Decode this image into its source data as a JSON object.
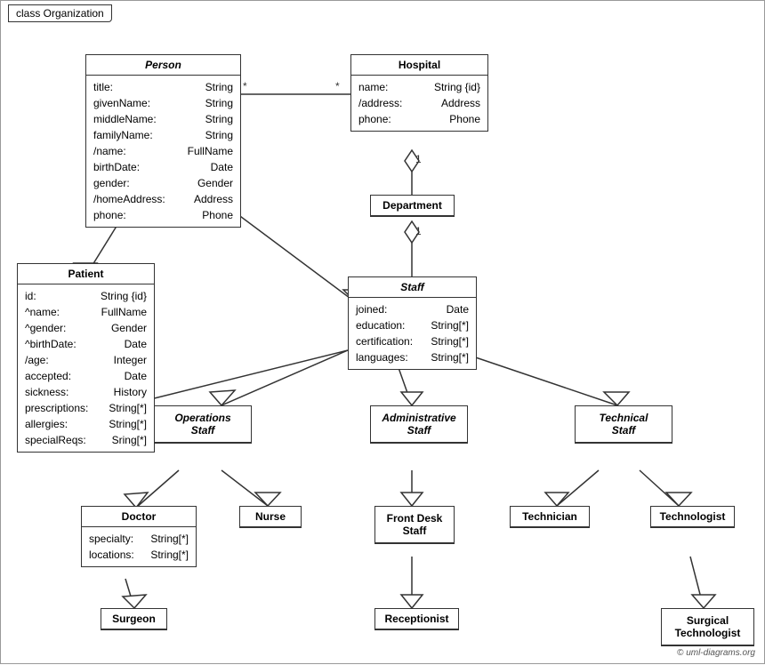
{
  "diagram": {
    "title": "class Organization",
    "copyright": "© uml-diagrams.org",
    "classes": {
      "person": {
        "name": "Person",
        "italic": true,
        "attributes": [
          {
            "name": "title:",
            "type": "String"
          },
          {
            "name": "givenName:",
            "type": "String"
          },
          {
            "name": "middleName:",
            "type": "String"
          },
          {
            "name": "familyName:",
            "type": "String"
          },
          {
            "name": "/name:",
            "type": "FullName"
          },
          {
            "name": "birthDate:",
            "type": "Date"
          },
          {
            "name": "gender:",
            "type": "Gender"
          },
          {
            "name": "/homeAddress:",
            "type": "Address"
          },
          {
            "name": "phone:",
            "type": "Phone"
          }
        ]
      },
      "hospital": {
        "name": "Hospital",
        "italic": false,
        "attributes": [
          {
            "name": "name:",
            "type": "String {id}"
          },
          {
            "name": "/address:",
            "type": "Address"
          },
          {
            "name": "phone:",
            "type": "Phone"
          }
        ]
      },
      "department": {
        "name": "Department",
        "italic": false,
        "attributes": []
      },
      "staff": {
        "name": "Staff",
        "italic": true,
        "attributes": [
          {
            "name": "joined:",
            "type": "Date"
          },
          {
            "name": "education:",
            "type": "String[*]"
          },
          {
            "name": "certification:",
            "type": "String[*]"
          },
          {
            "name": "languages:",
            "type": "String[*]"
          }
        ]
      },
      "patient": {
        "name": "Patient",
        "italic": false,
        "attributes": [
          {
            "name": "id:",
            "type": "String {id}"
          },
          {
            "name": "^name:",
            "type": "FullName"
          },
          {
            "name": "^gender:",
            "type": "Gender"
          },
          {
            "name": "^birthDate:",
            "type": "Date"
          },
          {
            "name": "/age:",
            "type": "Integer"
          },
          {
            "name": "accepted:",
            "type": "Date"
          },
          {
            "name": "sickness:",
            "type": "History"
          },
          {
            "name": "prescriptions:",
            "type": "String[*]"
          },
          {
            "name": "allergies:",
            "type": "String[*]"
          },
          {
            "name": "specialReqs:",
            "type": "Sring[*]"
          }
        ]
      },
      "operations_staff": {
        "name": "Operations Staff",
        "italic": true
      },
      "administrative_staff": {
        "name": "Administrative Staff",
        "italic": true
      },
      "technical_staff": {
        "name": "Technical Staff",
        "italic": true
      },
      "doctor": {
        "name": "Doctor",
        "italic": false,
        "attributes": [
          {
            "name": "specialty:",
            "type": "String[*]"
          },
          {
            "name": "locations:",
            "type": "String[*]"
          }
        ]
      },
      "nurse": {
        "name": "Nurse",
        "italic": false,
        "attributes": []
      },
      "front_desk_staff": {
        "name": "Front Desk Staff",
        "italic": false,
        "attributes": []
      },
      "technician": {
        "name": "Technician",
        "italic": false,
        "attributes": []
      },
      "technologist": {
        "name": "Technologist",
        "italic": false,
        "attributes": []
      },
      "surgeon": {
        "name": "Surgeon",
        "italic": false,
        "attributes": []
      },
      "receptionist": {
        "name": "Receptionist",
        "italic": false,
        "attributes": []
      },
      "surgical_technologist": {
        "name": "Surgical Technologist",
        "italic": false,
        "attributes": []
      }
    }
  }
}
